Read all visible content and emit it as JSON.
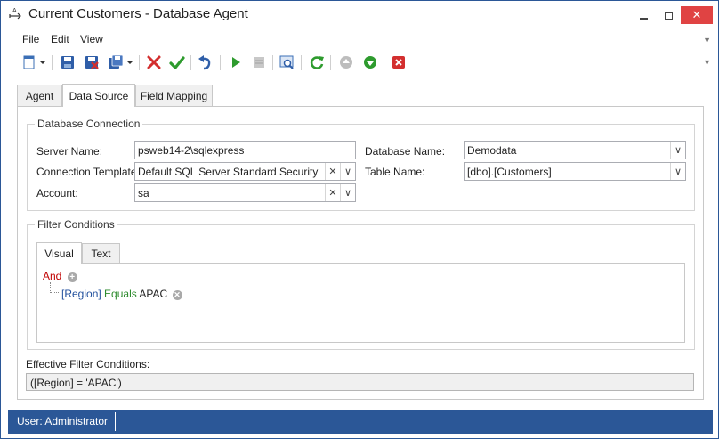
{
  "window": {
    "title": "Current Customers - Database Agent"
  },
  "menu": [
    "File",
    "Edit",
    "View"
  ],
  "toolbar": {
    "icons": [
      "new-icon",
      "dropdown-arrow-icon",
      "save-icon",
      "save-and-close-icon",
      "save-as-icon",
      "dropdown-arrow-icon",
      "delete-icon",
      "confirm-icon",
      "undo-icon",
      "run-icon",
      "stop-icon",
      "preview-icon",
      "refresh-icon",
      "move-up-icon",
      "move-down-icon",
      "close-red-icon"
    ]
  },
  "tabs": [
    {
      "label": "Agent",
      "active": false
    },
    {
      "label": "Data Source",
      "active": true
    },
    {
      "label": "Field Mapping",
      "active": false
    }
  ],
  "db_connection": {
    "title": "Database Connection",
    "server_name_label": "Server Name:",
    "server_name_value": "psweb14-2\\sqlexpress",
    "connection_template_label": "Connection Template:",
    "connection_template_value": "Default SQL Server Standard Security",
    "account_label": "Account:",
    "account_value": "sa",
    "database_name_label": "Database Name:",
    "database_name_value": "Demodata",
    "table_name_label": "Table Name:",
    "table_name_value": "[dbo].[Customers]"
  },
  "filter": {
    "title": "Filter Conditions",
    "tabs": [
      "Visual",
      "Text"
    ],
    "group_operator": "And",
    "condition": {
      "field": "[Region]",
      "operator": "Equals",
      "value": "APAC"
    }
  },
  "effective": {
    "label": "Effective Filter Conditions:",
    "value": "([Region] = 'APAC')"
  },
  "status": {
    "user": "User: Administrator"
  },
  "colors": {
    "accent": "#2b5797",
    "close_button": "#e04343",
    "operator_red": "#c00000",
    "field_blue": "#1f4e9c",
    "condition_green": "#2e8b2e"
  }
}
